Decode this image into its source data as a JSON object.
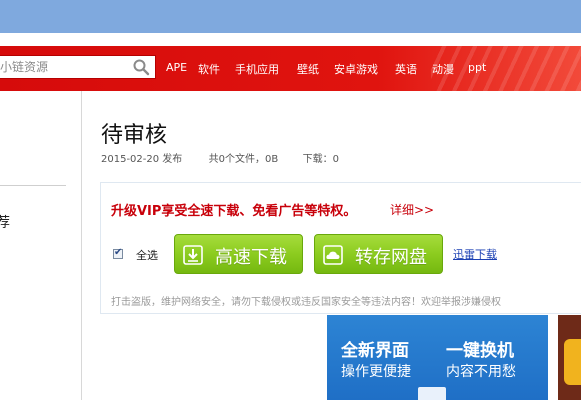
{
  "header": {
    "search": {
      "placeholder": "小链资源"
    },
    "nav": [
      "APE",
      "软件",
      "手机应用",
      "壁纸",
      "安卓游戏",
      "英语",
      "动漫",
      "ppt"
    ]
  },
  "sidebar": {
    "fragment_text": "荐"
  },
  "file": {
    "title": "待审核",
    "date": "2015-02-20 发布",
    "summary": "共0个文件，0B",
    "downloads": "下载：0"
  },
  "download_panel": {
    "vip_promo": "升级VIP享受全速下载、免看广告等特权。",
    "vip_link": "详细>>",
    "select_all": "全选",
    "fast_download": "高速下载",
    "save_to_disk": "转存网盘",
    "thunder_download": "迅雷下载",
    "disclaimer": "打击盗版，维护网络安全，请勿下载侵权或违反国家安全等违法内容！欢迎举报涉嫌侵权"
  },
  "ad_banner": {
    "headline_left": "全新界面",
    "headline_right": "一键换机",
    "sub_left": "操作更便捷",
    "sub_right": "内容不用愁"
  },
  "colors": {
    "top_blue": "#7fa9de",
    "header_red": "#e0140f",
    "promo_red": "#c8000a",
    "button_green": "#8ccc1f",
    "link_blue": "#1a3fb3",
    "banner_blue": "#1f6fc6"
  },
  "icons": {
    "search": "magnifier-icon",
    "fast_download": "download-arrow-icon",
    "save_to_disk": "cloud-icon"
  }
}
